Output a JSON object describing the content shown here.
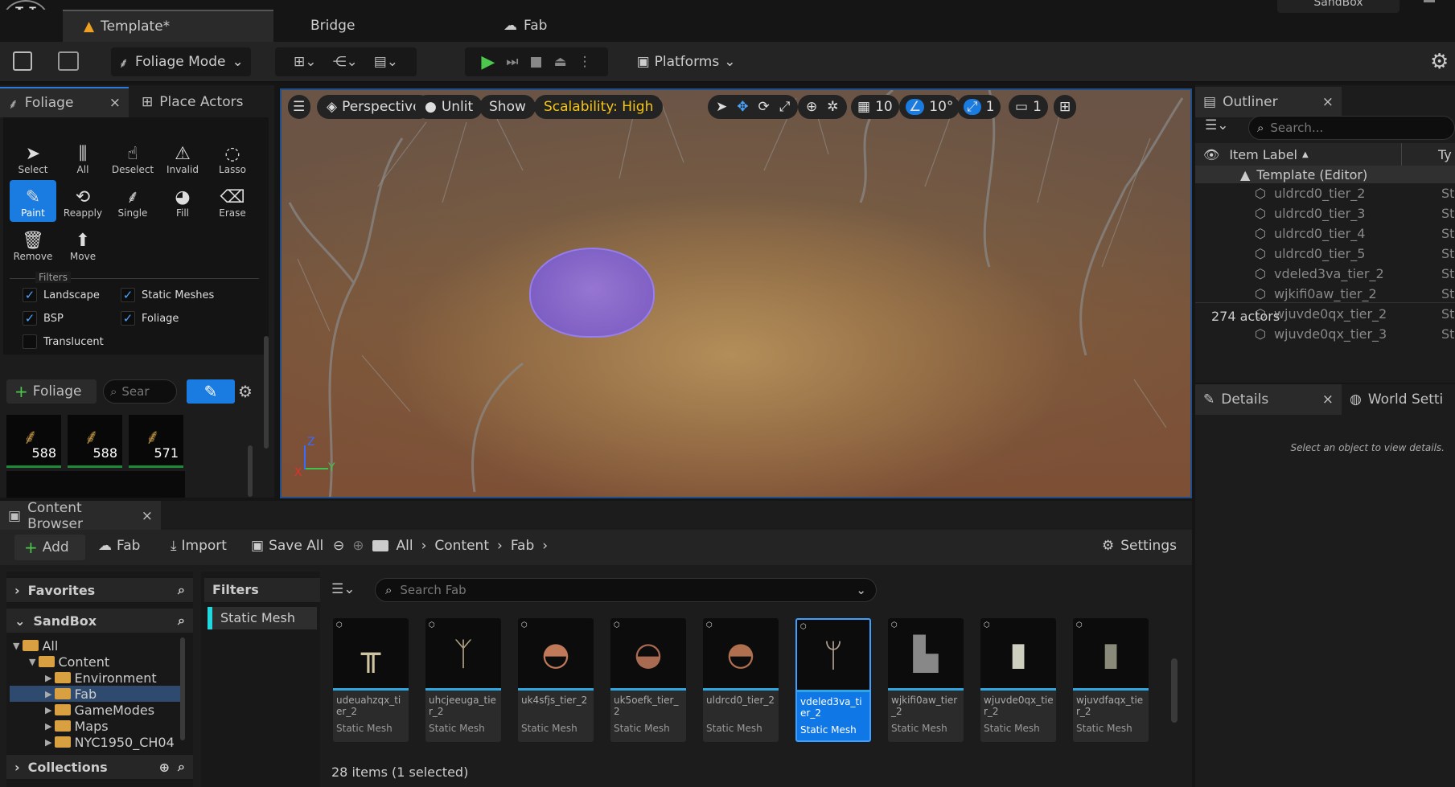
{
  "app": {
    "logo": "U"
  },
  "tabs": {
    "template": "Template*",
    "bridge": "Bridge",
    "fab": "Fab",
    "sandbox": "SandBox"
  },
  "toolbar": {
    "mode": "Foliage Mode",
    "platforms": "Platforms"
  },
  "left": {
    "tab_foliage": "Foliage",
    "tab_place": "Place Actors",
    "tools": [
      {
        "label": "Select",
        "icon": "select-icon"
      },
      {
        "label": "All",
        "icon": "all-icon"
      },
      {
        "label": "Deselect",
        "icon": "deselect-icon"
      },
      {
        "label": "Invalid",
        "icon": "invalid-icon"
      },
      {
        "label": "Lasso",
        "icon": "lasso-icon"
      },
      {
        "label": "Paint",
        "icon": "paint-icon"
      },
      {
        "label": "Reapply",
        "icon": "reapply-icon"
      },
      {
        "label": "Single",
        "icon": "single-icon"
      },
      {
        "label": "Fill",
        "icon": "fill-icon"
      },
      {
        "label": "Erase",
        "icon": "erase-icon"
      },
      {
        "label": "Remove",
        "icon": "remove-icon"
      },
      {
        "label": "Move",
        "icon": "move-icon"
      }
    ],
    "filters_title": "Filters",
    "filters": [
      {
        "label": "Landscape",
        "checked": true
      },
      {
        "label": "Static Meshes",
        "checked": true
      },
      {
        "label": "BSP",
        "checked": true
      },
      {
        "label": "Foliage",
        "checked": true
      },
      {
        "label": "Translucent",
        "checked": false
      }
    ],
    "add_foliage": "Foliage",
    "search_placeholder": "Sear",
    "thumbs": [
      "588",
      "588",
      "571"
    ]
  },
  "viewport": {
    "perspective": "Perspective",
    "unlit": "Unlit",
    "show": "Show",
    "scalability": "Scalability: High",
    "grid": "10",
    "angle": "10°",
    "scale": "1",
    "camera": "1",
    "axis_x": "X",
    "axis_y": "Y",
    "axis_z": "Z"
  },
  "outliner": {
    "title": "Outliner",
    "search_placeholder": "Search...",
    "col_label": "Item Label",
    "col_type": "Ty",
    "root": "Template (Editor)",
    "items": [
      {
        "name": "uldrcd0_tier_2",
        "type": "St"
      },
      {
        "name": "uldrcd0_tier_3",
        "type": "St"
      },
      {
        "name": "uldrcd0_tier_4",
        "type": "St"
      },
      {
        "name": "uldrcd0_tier_5",
        "type": "St"
      },
      {
        "name": "vdeled3va_tier_2",
        "type": "St"
      },
      {
        "name": "wjkifi0aw_tier_2",
        "type": "St"
      },
      {
        "name": "wjuvde0qx_tier_2",
        "type": "St"
      },
      {
        "name": "wjuvde0qx_tier_3",
        "type": "St"
      }
    ],
    "count": "274 actors"
  },
  "details": {
    "title": "Details",
    "world_settings": "World Setti",
    "hint": "Select an object to view details."
  },
  "content_browser": {
    "title": "Content Browser",
    "add": "Add",
    "fab": "Fab",
    "import": "Import",
    "save_all": "Save All",
    "path": [
      "All",
      "Content",
      "Fab"
    ],
    "settings": "Settings",
    "favorites": "Favorites",
    "sandbox": "SandBox",
    "collections": "Collections",
    "filters": "Filters",
    "filter_chip": "Static Mesh",
    "search_placeholder": "Search Fab",
    "tree": [
      {
        "label": "All",
        "depth": 0
      },
      {
        "label": "Content",
        "depth": 1
      },
      {
        "label": "Environment",
        "depth": 2
      },
      {
        "label": "Fab",
        "depth": 2
      },
      {
        "label": "GameModes",
        "depth": 2
      },
      {
        "label": "Maps",
        "depth": 2
      },
      {
        "label": "NYC1950_CH04",
        "depth": 2
      }
    ],
    "assets": [
      {
        "name": "udeuahzqx_tier_2",
        "type": "Static Mesh"
      },
      {
        "name": "uhcjeeuga_tier_2",
        "type": "Static Mesh"
      },
      {
        "name": "uk4sfjs_tier_2",
        "type": "Static Mesh"
      },
      {
        "name": "uk5oefk_tier_2",
        "type": "Static Mesh"
      },
      {
        "name": "uldrcd0_tier_2",
        "type": "Static Mesh"
      },
      {
        "name": "vdeled3va_tier_2",
        "type": "Static Mesh"
      },
      {
        "name": "wjkifi0aw_tier_2",
        "type": "Static Mesh"
      },
      {
        "name": "wjuvde0qx_tier_2",
        "type": "Static Mesh"
      },
      {
        "name": "wjuvdfaqx_tier_2",
        "type": "Static Mesh"
      }
    ],
    "status": "28 items (1 selected)"
  }
}
